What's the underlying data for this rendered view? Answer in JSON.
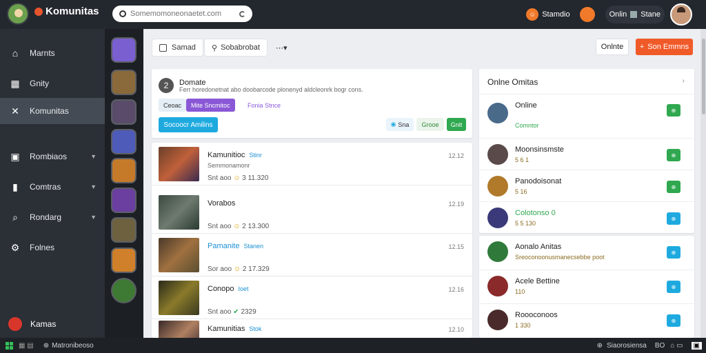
{
  "topbar": {
    "brand": "Komunitas",
    "search_placeholder": "Somemomoneonaetet.com",
    "user1": "Stamdio",
    "online_label": "Onlin",
    "online_status": "Stane"
  },
  "sidebar": {
    "items": [
      {
        "label": "Marnts"
      },
      {
        "label": "Gnity"
      },
      {
        "label": "Komunitas"
      },
      {
        "label": "Rombiaos"
      },
      {
        "label": "Comtras"
      },
      {
        "label": "Rondarg"
      },
      {
        "label": "Folnes"
      }
    ],
    "footer": "Kamas"
  },
  "toolbar": {
    "btn1": "Samad",
    "btn2": "Sobabrobat",
    "online_btn": "Onlnte",
    "orange_btn": "Son Emmns"
  },
  "composer": {
    "title": "Domate",
    "text": "Ferr horedonetnat abo doobarcode plonenyd aldcleonrk bogr cons.",
    "tags": [
      "Ceoac",
      "Mite Sncmitoc",
      "Fonia Stnce"
    ],
    "primary_btn": "Socoocr Amilins",
    "btn_a": "Sna",
    "btn_b": "Grooe",
    "btn_c": "Gnit"
  },
  "feed": [
    {
      "title": "Kamunitioc",
      "tag": "Stinr",
      "sub": "Semmonamonr",
      "meta": "Snt aoo",
      "score": "3 11.320",
      "num": "12.12"
    },
    {
      "title": "Vorabos",
      "tag": "",
      "sub": "",
      "meta": "Snt aoo",
      "score": "2 13.300",
      "num": "12.19"
    },
    {
      "title": "Pamanite",
      "tag": "Stanen",
      "sub": "",
      "meta": "Sor aoo",
      "score": "2 17.329",
      "num": "12.15"
    },
    {
      "title": "Conopo",
      "tag": "Ioet",
      "sub": "",
      "meta": "Snt aoo",
      "score": "2329",
      "num": "12.16"
    },
    {
      "title": "Kamunitias",
      "tag": "Stok",
      "sub": "",
      "meta": "",
      "score": "",
      "num": "12.10"
    }
  ],
  "online_panel": {
    "title": "Onlne Omitas",
    "rows": [
      {
        "name": "Online",
        "sub": "Comntor"
      },
      {
        "name": "Moonsinsmste",
        "sub": "5 6 1"
      },
      {
        "name": "Panodoisonat",
        "sub": "5 16"
      },
      {
        "name": "Colotonso 0",
        "sub": "5 5 130"
      }
    ]
  },
  "panel2": {
    "rows": [
      {
        "name": "Aonalo Anitas",
        "sub": "Sreoconoonusmanecsebbe poot"
      },
      {
        "name": "Acele Bettine",
        "sub": "110"
      },
      {
        "name": "Roooconoos",
        "sub": "1 330"
      }
    ]
  },
  "statusbar": {
    "left": "Matronibeoso",
    "right1": "Siaorosiensa",
    "right2": "BO"
  },
  "colors": {
    "accent": "#f05a28",
    "blue": "#1eaadf",
    "green": "#2fa84f",
    "purple": "#8a58d6"
  }
}
